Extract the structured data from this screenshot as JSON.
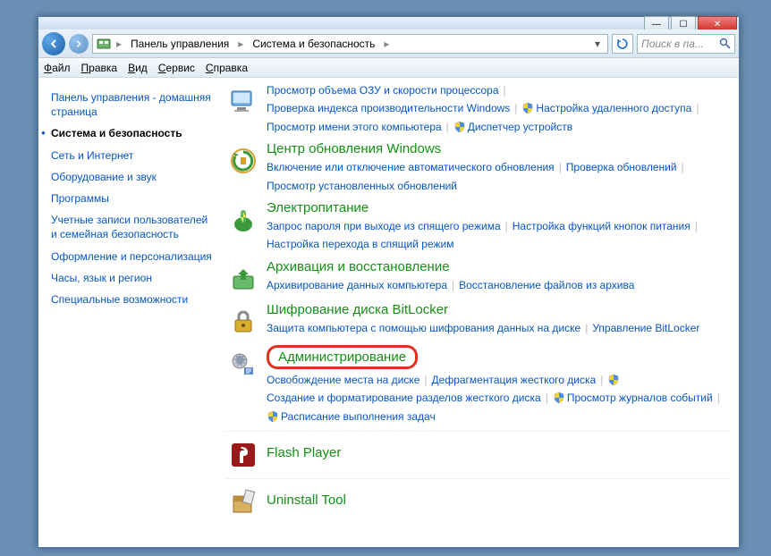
{
  "titlebar": {
    "min": "—",
    "max": "☐",
    "close": "✕"
  },
  "nav": {
    "crumbs": [
      "Панель управления",
      "Система и безопасность"
    ],
    "search_placeholder": "Поиск в па..."
  },
  "menu": [
    "Файл",
    "Правка",
    "Вид",
    "Сервис",
    "Справка"
  ],
  "sidebar": {
    "items": [
      {
        "label": "Панель управления - домашняя страница",
        "active": false
      },
      {
        "label": "Система и безопасность",
        "active": true
      },
      {
        "label": "Сеть и Интернет",
        "active": false
      },
      {
        "label": "Оборудование и звук",
        "active": false
      },
      {
        "label": "Программы",
        "active": false
      },
      {
        "label": "Учетные записи пользователей и семейная безопасность",
        "active": false
      },
      {
        "label": "Оформление и персонализация",
        "active": false
      },
      {
        "label": "Часы, язык и регион",
        "active": false
      },
      {
        "label": "Специальные возможности",
        "active": false
      }
    ]
  },
  "categories": [
    {
      "icon": "system",
      "title": "",
      "links": [
        {
          "t": "Просмотр объема ОЗУ и скорости процессора",
          "s": false
        },
        {
          "t": "Проверка индекса производительности Windows",
          "s": false
        },
        {
          "t": "Настройка удаленного доступа",
          "s": true
        },
        {
          "t": "Просмотр имени этого компьютера",
          "s": false
        },
        {
          "t": "Диспетчер устройств",
          "s": true
        }
      ]
    },
    {
      "icon": "update",
      "title": "Центр обновления Windows",
      "links": [
        {
          "t": "Включение или отключение автоматического обновления",
          "s": false
        },
        {
          "t": "Проверка обновлений",
          "s": false
        },
        {
          "t": "Просмотр установленных обновлений",
          "s": false
        }
      ]
    },
    {
      "icon": "power",
      "title": "Электропитание",
      "links": [
        {
          "t": "Запрос пароля при выходе из спящего режима",
          "s": false
        },
        {
          "t": "Настройка функций кнопок питания",
          "s": false
        },
        {
          "t": "Настройка перехода в спящий режим",
          "s": false
        }
      ]
    },
    {
      "icon": "backup",
      "title": "Архивация и восстановление",
      "links": [
        {
          "t": "Архивирование данных компьютера",
          "s": false
        },
        {
          "t": "Восстановление файлов из архива",
          "s": false
        }
      ]
    },
    {
      "icon": "bitlocker",
      "title": "Шифрование диска BitLocker",
      "links": [
        {
          "t": "Защита компьютера с помощью шифрования данных на диске",
          "s": false
        },
        {
          "t": "Управление BitLocker",
          "s": false
        }
      ]
    },
    {
      "icon": "admin",
      "title": "Администрирование",
      "highlight": true,
      "links": [
        {
          "t": "Освобождение места на диске",
          "s": false
        },
        {
          "t": "Дефрагментация жесткого диска",
          "s": false
        },
        {
          "t": "Создание и форматирование разделов жесткого диска",
          "s": true
        },
        {
          "t": "Просмотр журналов событий",
          "s": true
        },
        {
          "t": "Расписание выполнения задач",
          "s": true
        }
      ]
    },
    {
      "icon": "flash",
      "title": "Flash Player",
      "simple": true
    },
    {
      "icon": "uninstall",
      "title": "Uninstall Tool",
      "simple": true
    }
  ]
}
